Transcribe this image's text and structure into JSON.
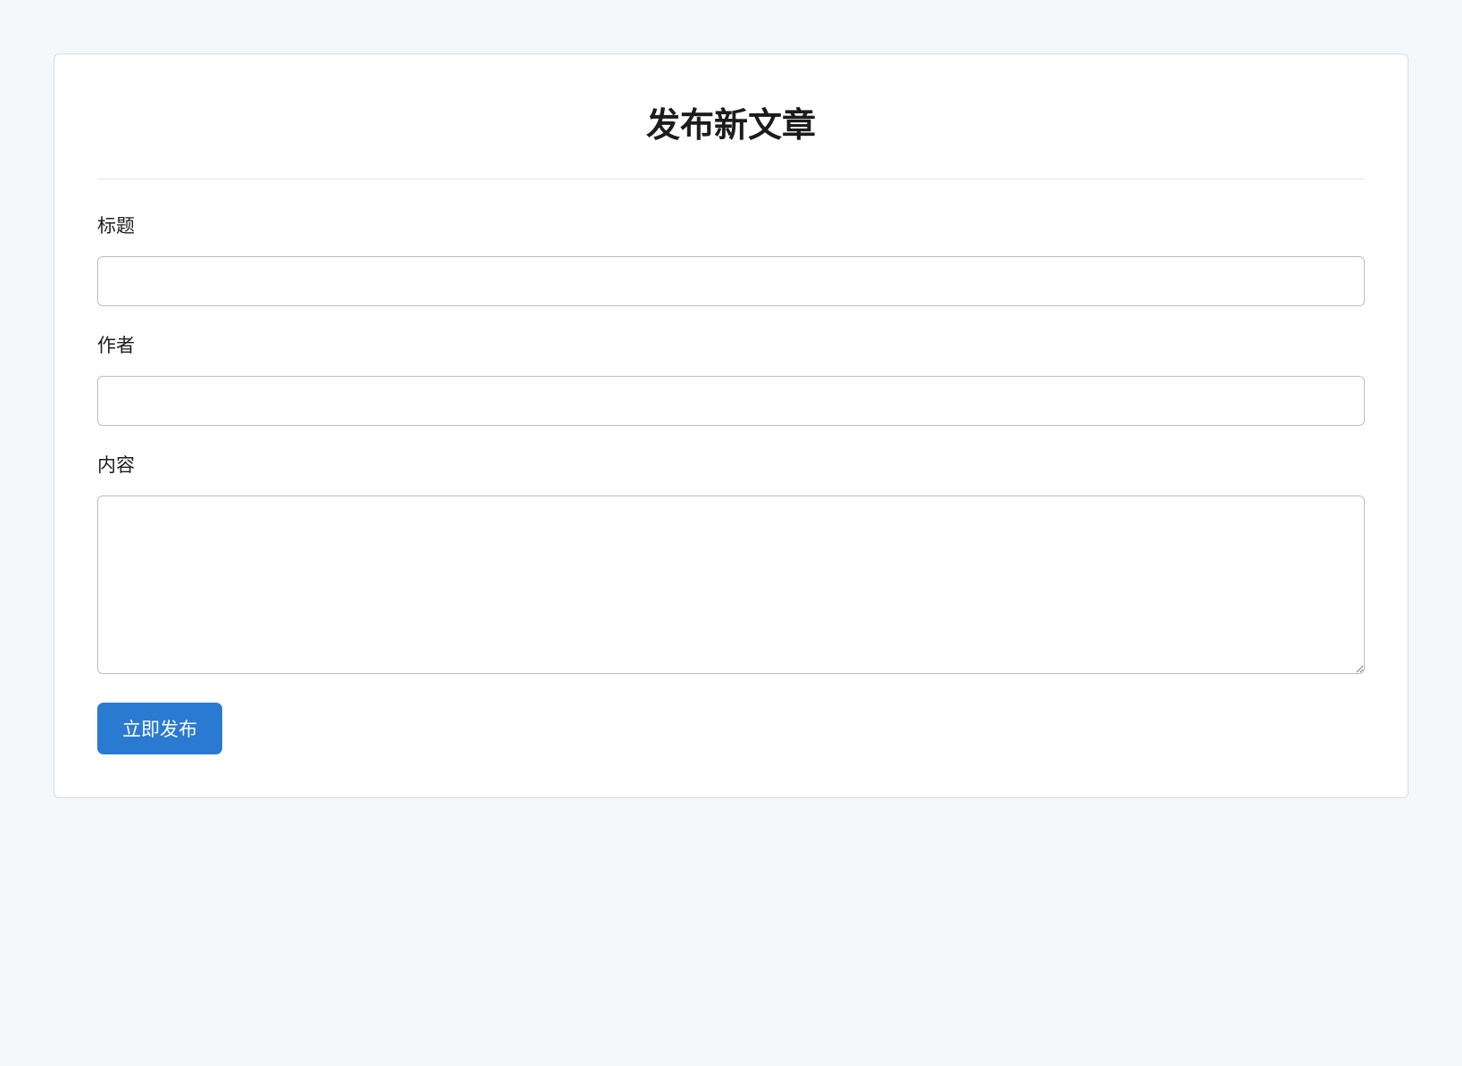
{
  "header": {
    "title": "发布新文章"
  },
  "form": {
    "title": {
      "label": "标题",
      "value": ""
    },
    "author": {
      "label": "作者",
      "value": ""
    },
    "content": {
      "label": "内容",
      "value": ""
    },
    "submit_label": "立即发布"
  }
}
